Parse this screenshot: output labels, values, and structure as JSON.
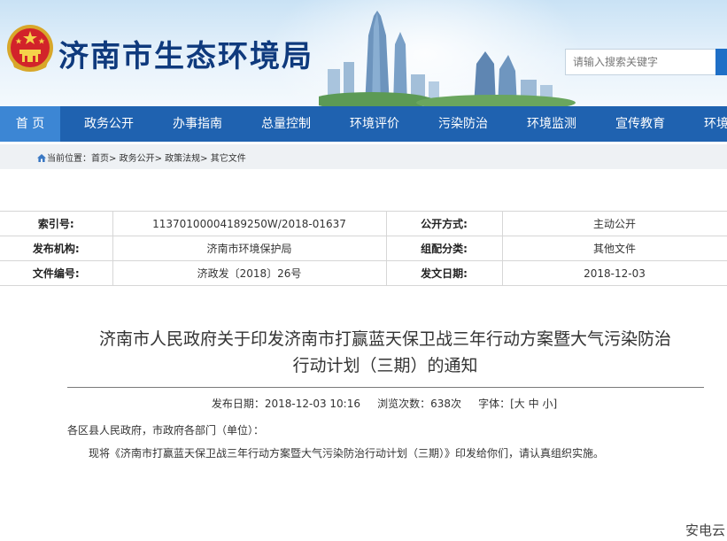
{
  "header": {
    "site_title": "济南市生态环境局",
    "search_placeholder": "请输入搜索关键字"
  },
  "nav": {
    "items": [
      "首 页",
      "政务公开",
      "办事指南",
      "总量控制",
      "环境评价",
      "污染防治",
      "环境监测",
      "宣传教育",
      "环境"
    ],
    "active_index": 0
  },
  "breadcrumb": {
    "prefix": "当前位置：",
    "items": [
      "首页",
      "政务公开",
      "政策法规",
      "其它文件"
    ],
    "separator": ">"
  },
  "info_table": {
    "rows": [
      {
        "k1": "索引号:",
        "v1": "11370100004189250W/2018-01637",
        "k2": "公开方式:",
        "v2": "主动公开"
      },
      {
        "k1": "发布机构:",
        "v1": "济南市环境保护局",
        "k2": "组配分类:",
        "v2": "其他文件"
      },
      {
        "k1": "文件编号:",
        "v1": "济政发〔2018〕26号",
        "k2": "发文日期:",
        "v2": "2018-12-03"
      }
    ]
  },
  "article": {
    "title_line1": "济南市人民政府关于印发济南市打赢蓝天保卫战三年行动方案暨大气污染防治",
    "title_line2": "行动计划（三期）的通知",
    "meta_date_label": "发布日期：",
    "meta_date": "2018-12-03 10:16",
    "meta_views_label": "浏览次数：",
    "meta_views": "638",
    "meta_views_unit": "次",
    "meta_font_label": "字体：",
    "font_sizes": [
      "大",
      "中",
      "小"
    ],
    "salutation": "各区县人民政府，市政府各部门（单位）：",
    "body": "现将《济南市打赢蓝天保卫战三年行动方案暨大气污染防治行动计划（三期）》印发给你们，请认真组织实施。"
  },
  "watermark": "安电云",
  "colors": {
    "nav_bg": "#1f62b0",
    "nav_active": "#3c86d4",
    "title_blue": "#0f3a7d",
    "search_btn": "#1f6fc6"
  }
}
